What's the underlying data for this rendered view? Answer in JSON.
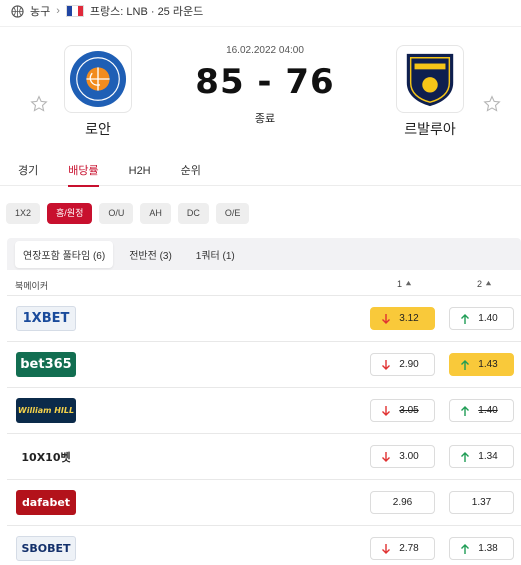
{
  "breadcrumb": {
    "sport": "농구",
    "league": "프랑스: LNB · 25 라운드"
  },
  "colors": {
    "accent": "#c8102e",
    "highlight": "#f9c93a",
    "up": "#1f9d55",
    "down": "#e03131"
  },
  "match": {
    "date": "16.02.2022 04:00",
    "score": "85 - 76",
    "status": "종료",
    "home": {
      "name": "로안"
    },
    "away": {
      "name": "르발루아"
    }
  },
  "tabs": [
    "경기",
    "배당률",
    "H2H",
    "순위"
  ],
  "active_tab": 1,
  "markets": [
    "1X2",
    "홈/원정",
    "O/U",
    "AH",
    "DC",
    "O/E"
  ],
  "active_market": 1,
  "periods": [
    "연장포함 풀타임 (6)",
    "전반전 (3)",
    "1쿼터 (1)"
  ],
  "active_period": 0,
  "table": {
    "bookmaker_header": "북메이커",
    "col1": "1",
    "col2": "2"
  },
  "bookmakers": [
    {
      "name": "1XBET",
      "odd1": "3.12",
      "odd1_dir": "down",
      "odd1_hl": true,
      "odd2": "1.40",
      "odd2_dir": "up",
      "odd2_hl": false,
      "strike": false
    },
    {
      "name": "bet365",
      "odd1": "2.90",
      "odd1_dir": "down",
      "odd1_hl": false,
      "odd2": "1.43",
      "odd2_dir": "up",
      "odd2_hl": true,
      "strike": false
    },
    {
      "name": "William HILL",
      "odd1": "3.05",
      "odd1_dir": "down",
      "odd1_hl": false,
      "odd2": "1.40",
      "odd2_dir": "up",
      "odd2_hl": false,
      "strike": true
    },
    {
      "name": "10X10벳",
      "odd1": "3.00",
      "odd1_dir": "down",
      "odd1_hl": false,
      "odd2": "1.34",
      "odd2_dir": "up",
      "odd2_hl": false,
      "strike": false
    },
    {
      "name": "dafabet",
      "odd1": "2.96",
      "odd1_dir": "none",
      "odd1_hl": false,
      "odd2": "1.37",
      "odd2_dir": "none",
      "odd2_hl": false,
      "strike": false
    },
    {
      "name": "SBOBET",
      "odd1": "2.78",
      "odd1_dir": "down",
      "odd1_hl": false,
      "odd2": "1.38",
      "odd2_dir": "up",
      "odd2_hl": false,
      "strike": false
    }
  ]
}
